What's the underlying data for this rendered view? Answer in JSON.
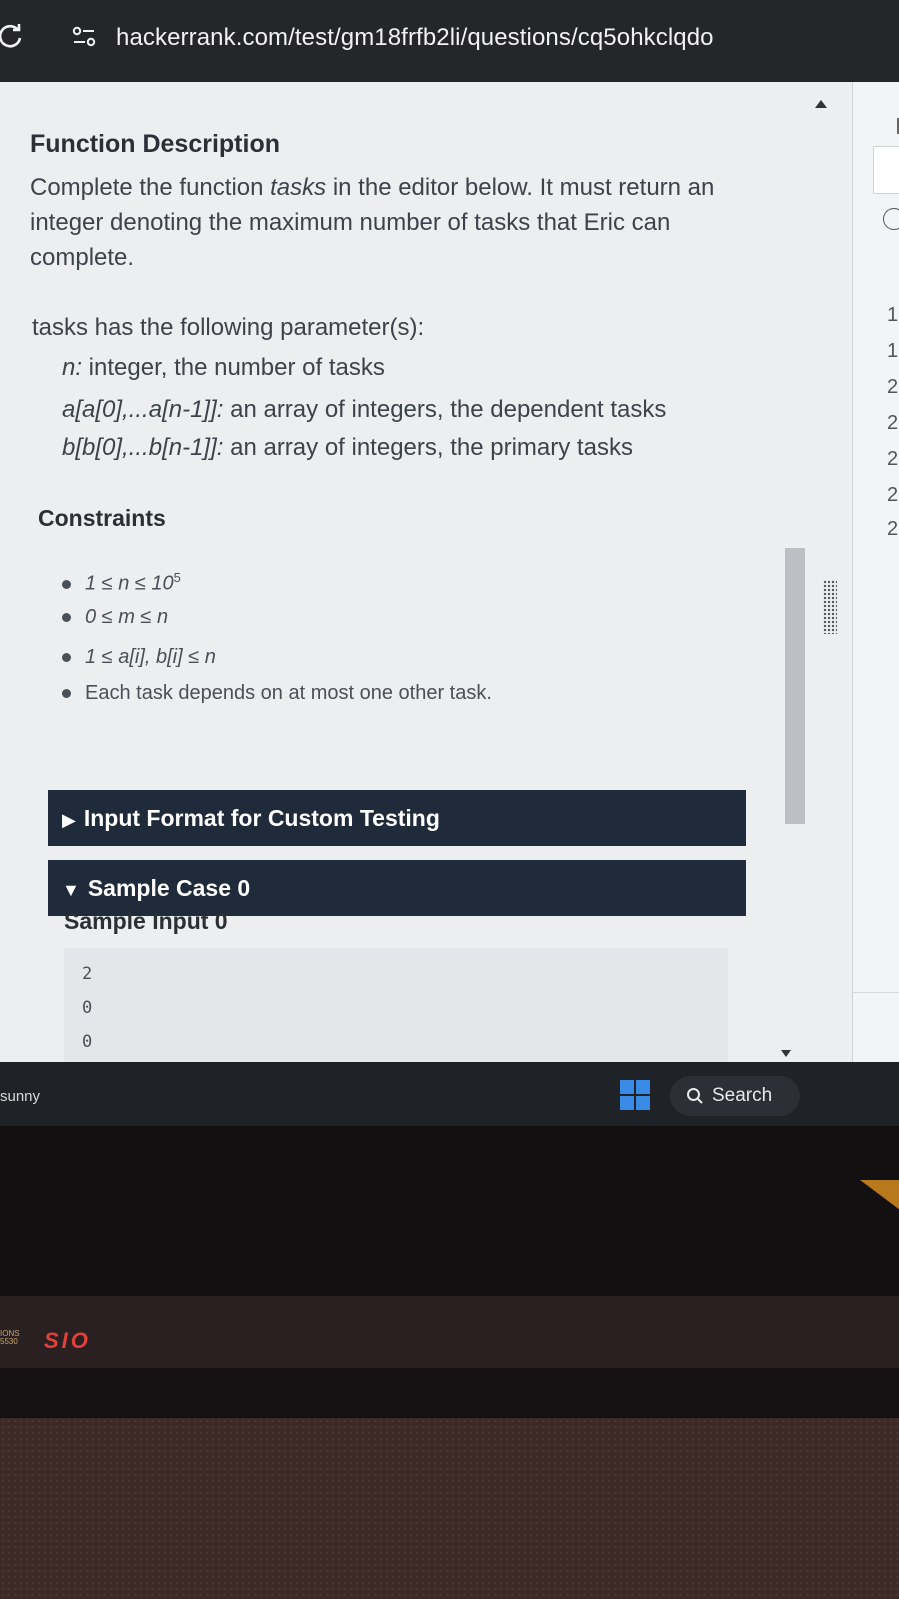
{
  "browser": {
    "url": "hackerrank.com/test/gm18frfb2li/questions/cq5ohkclqdo"
  },
  "problem": {
    "function_description_heading": "Function Description",
    "desc_prefix": "Complete the function ",
    "desc_fn": "tasks",
    "desc_suffix": " in the editor below. It must return an integer denoting the maximum number of tasks that Eric can complete.",
    "params_intro": "tasks has the following parameter(s):",
    "params": [
      {
        "name": "n:",
        "text": " integer, the number of tasks"
      },
      {
        "name": "a[a[0],...a[n-1]]:",
        "text": " an array of integers, the dependent tasks"
      },
      {
        "name": "b[b[0],...b[n-1]]:",
        "text": " an array of integers, the primary tasks"
      }
    ],
    "constraints_heading": "Constraints",
    "constraints": [
      {
        "text": "1 ≤ n ≤ 10",
        "sup": "5"
      },
      {
        "text": "0 ≤ m ≤ n"
      },
      {
        "text": "1 ≤ a[i], b[i] ≤ n"
      },
      {
        "text": "Each task depends on at most one other task."
      }
    ],
    "input_format": {
      "arrow": "▶",
      "label": "Input Format for Custom Testing"
    },
    "sample_case": {
      "arrow": "▼",
      "label": "Sample Case 0"
    },
    "sample_input_heading": "Sample Input 0",
    "sample_input_lines": [
      "2",
      "0",
      "0"
    ]
  },
  "right_panel": {
    "line_numbers": [
      "1",
      "1",
      "2",
      "2",
      "2",
      "2",
      "2"
    ]
  },
  "taskbar": {
    "weather": "sunny",
    "search_label": "Search"
  },
  "laptop": {
    "brand": "SIO",
    "brand_small": "IONS\n5530"
  },
  "colors": {
    "header_bar": "#1f2a3a",
    "page_bg": "#eceef0",
    "windows_blue": "#3a8be6",
    "brand_red": "#e0413b"
  }
}
